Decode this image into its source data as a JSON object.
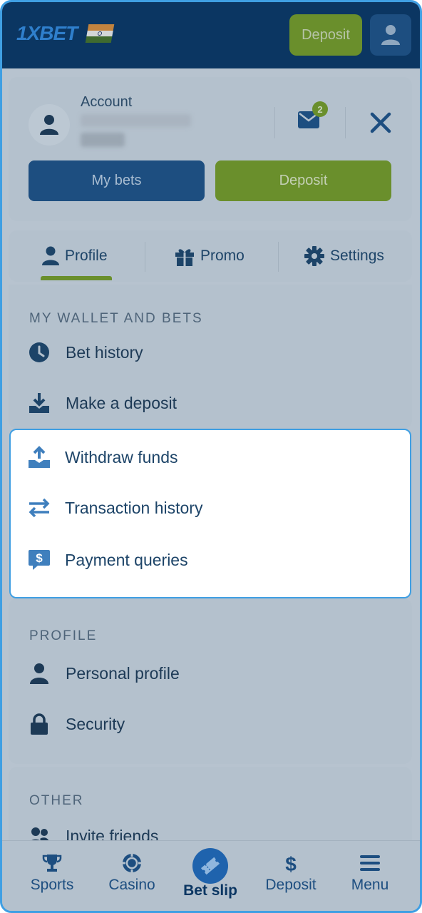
{
  "header": {
    "logo": "1XBET",
    "deposit_label": "Deposit"
  },
  "account": {
    "label": "Account",
    "mail_count": "2",
    "my_bets_label": "My bets",
    "deposit_label": "Deposit"
  },
  "tabs": [
    {
      "label": "Profile",
      "icon": "person-icon"
    },
    {
      "label": "Promo",
      "icon": "gift-icon"
    },
    {
      "label": "Settings",
      "icon": "gear-icon"
    }
  ],
  "wallet_section": {
    "title": "MY WALLET AND BETS",
    "items": [
      {
        "label": "Bet history",
        "icon": "clock-icon"
      },
      {
        "label": "Make a deposit",
        "icon": "download-icon"
      },
      {
        "label": "Withdraw funds",
        "icon": "upload-icon"
      },
      {
        "label": "Transaction history",
        "icon": "transfer-arrows-icon"
      },
      {
        "label": "Payment queries",
        "icon": "dollar-chat-icon"
      }
    ]
  },
  "profile_section": {
    "title": "PROFILE",
    "items": [
      {
        "label": "Personal profile",
        "icon": "person-icon"
      },
      {
        "label": "Security",
        "icon": "lock-icon"
      }
    ]
  },
  "other_section": {
    "title": "OTHER",
    "items": [
      {
        "label": "Invite friends",
        "icon": "users-icon"
      }
    ]
  },
  "bottom_nav": [
    {
      "label": "Sports",
      "icon": "trophy-icon"
    },
    {
      "label": "Casino",
      "icon": "chip-icon"
    },
    {
      "label": "Bet slip",
      "icon": "ticket-icon"
    },
    {
      "label": "Deposit",
      "icon": "dollar-icon"
    },
    {
      "label": "Menu",
      "icon": "menu-icon"
    }
  ],
  "colors": {
    "brand_blue": "#0b3662",
    "accent_green": "#6a8f2c",
    "highlight_border": "#3f9fe3"
  }
}
